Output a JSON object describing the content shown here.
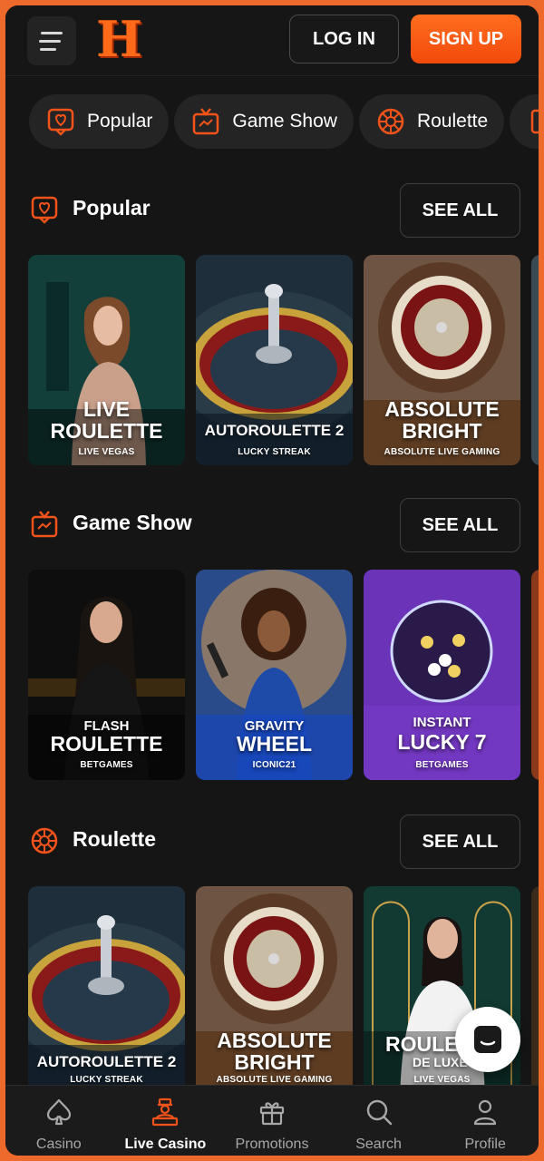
{
  "header": {
    "logo": "H",
    "login_label": "LOG IN",
    "signup_label": "SIGN UP"
  },
  "filters": [
    {
      "label": "Popular",
      "icon": "heart-chat-icon"
    },
    {
      "label": "Game Show",
      "icon": "tv-icon"
    },
    {
      "label": "Roulette",
      "icon": "roulette-wheel-icon"
    }
  ],
  "sections": [
    {
      "title": "Popular",
      "see_all": "SEE ALL",
      "cards": [
        {
          "line1": "LIVE",
          "line2": "ROULETTE",
          "provider": "LIVE VEGAS"
        },
        {
          "line1": "AUTOROULETTE 2",
          "provider": "LUCKY STREAK"
        },
        {
          "line1": "ABSOLUTE",
          "line2": "BRIGHT",
          "provider": "ABSOLUTE LIVE GAMING"
        }
      ]
    },
    {
      "title": "Game Show",
      "see_all": "SEE ALL",
      "cards": [
        {
          "line1": "FLASH",
          "line2": "ROULETTE",
          "provider": "BETGAMES"
        },
        {
          "line1": "GRAVITY",
          "line2": "WHEEL",
          "provider": "ICONIC21"
        },
        {
          "line1": "INSTANT",
          "line2": "LUCKY 7",
          "provider": "BETGAMES"
        }
      ]
    },
    {
      "title": "Roulette",
      "see_all": "SEE ALL",
      "cards": [
        {
          "line1": "AUTOROULETTE 2",
          "provider": "LUCKY STREAK"
        },
        {
          "line1": "ABSOLUTE",
          "line2": "BRIGHT",
          "provider": "ABSOLUTE LIVE GAMING"
        },
        {
          "line1": "ROULE",
          "line2": "DE LUXE",
          "provider": "LIVE VEGAS"
        }
      ]
    }
  ],
  "nav": [
    {
      "label": "Casino",
      "icon": "spade-icon"
    },
    {
      "label": "Live Casino",
      "icon": "dealer-icon",
      "active": true
    },
    {
      "label": "Promotions",
      "icon": "gift-icon"
    },
    {
      "label": "Search",
      "icon": "search-icon"
    },
    {
      "label": "Profile",
      "icon": "user-icon"
    }
  ],
  "colors": {
    "accent": "#f3531a",
    "background": "#151515",
    "chip": "#242424"
  }
}
